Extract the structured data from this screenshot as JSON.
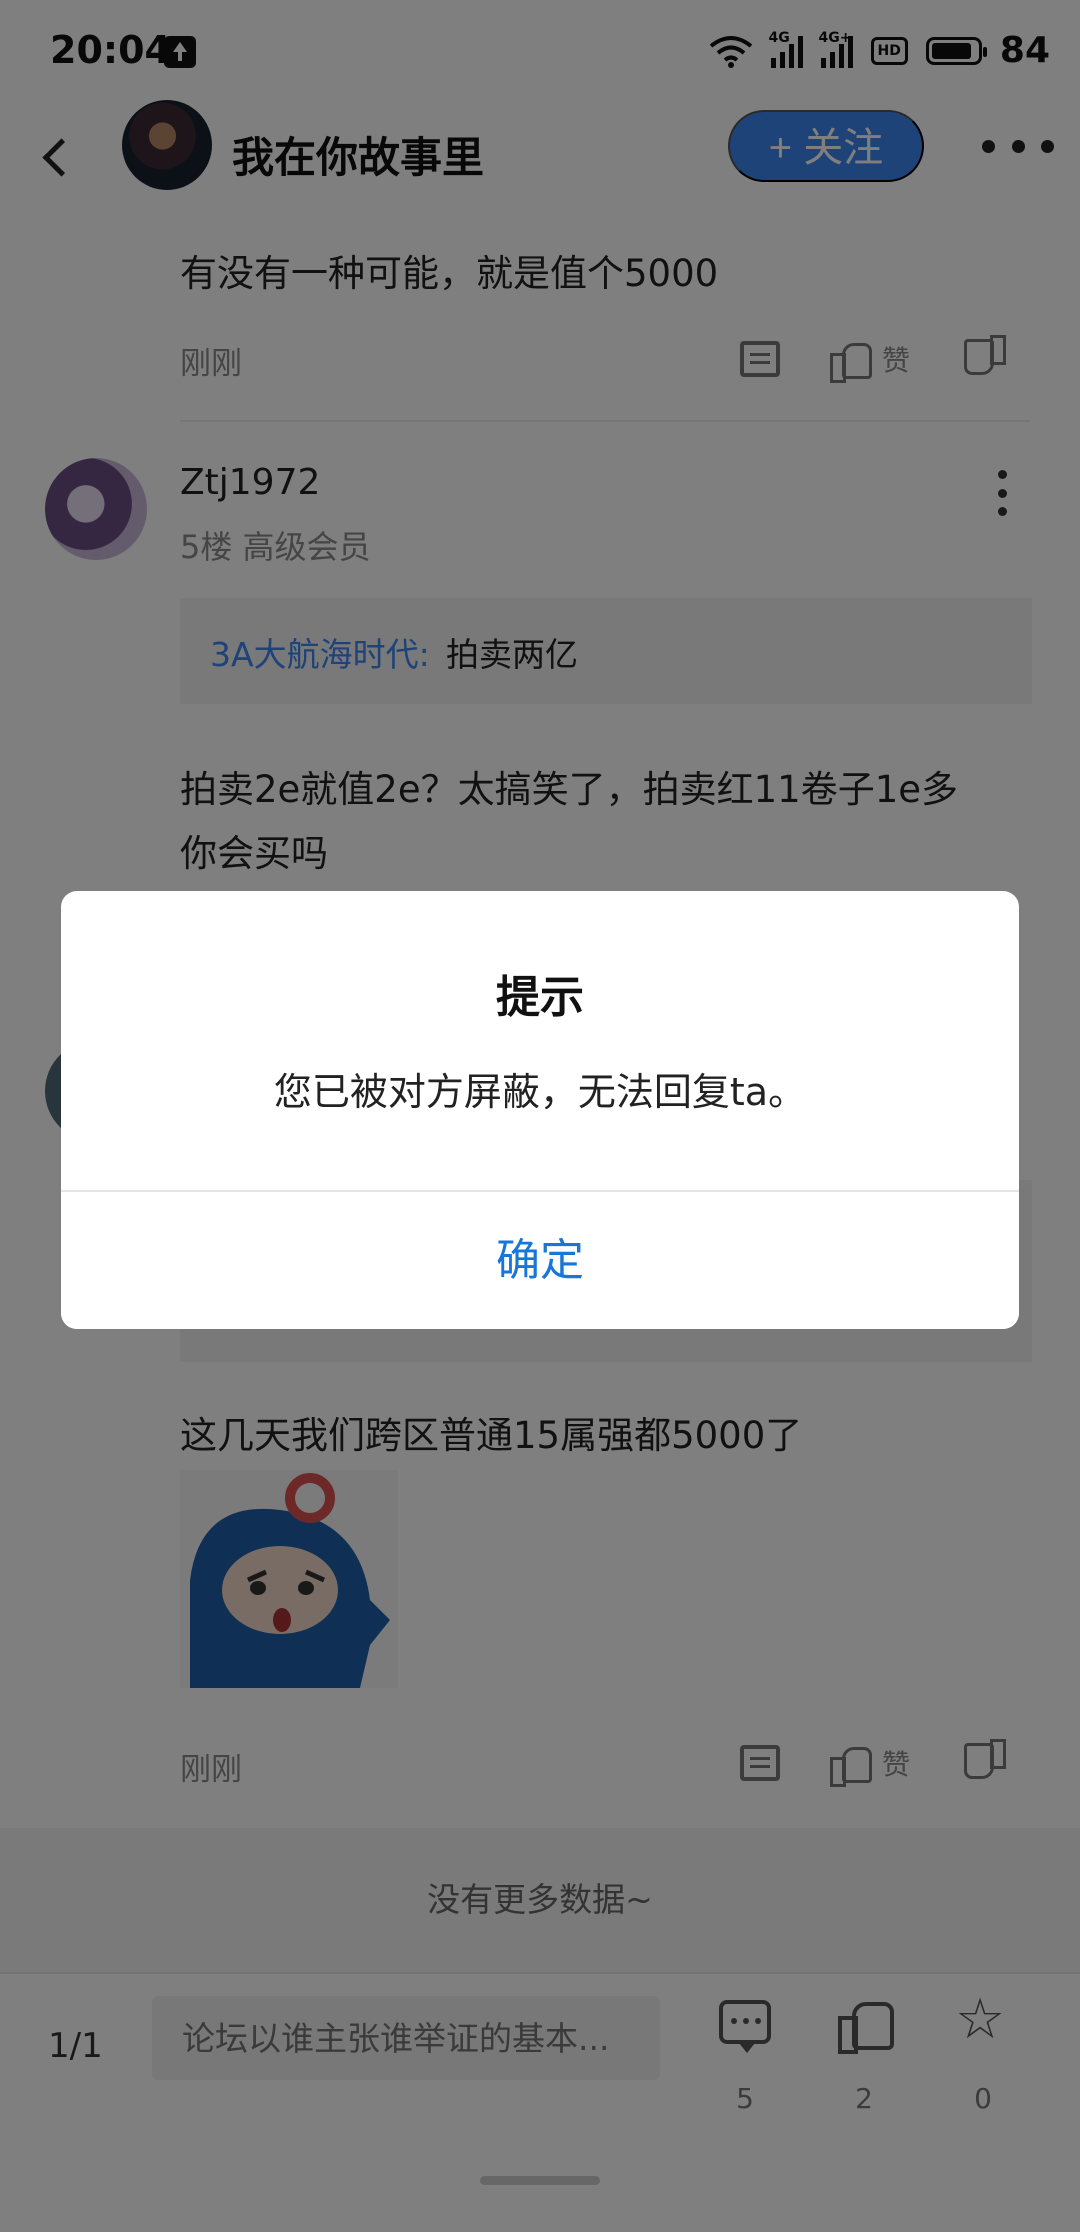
{
  "status_bar": {
    "time": "20:04",
    "signal_1": "4G",
    "signal_2": "4G+",
    "hd_label": "HD",
    "battery": "84"
  },
  "header": {
    "author_name": "我在你故事里",
    "follow_label": "+ 关注"
  },
  "post_1": {
    "text": "有没有一种可能，就是值个5000",
    "time": "刚刚",
    "like_label": "赞"
  },
  "post_2": {
    "username": "Ztj1972",
    "floor_info": "5楼 高级会员",
    "quote_user": "3A大航海时代:",
    "quote_text": "拍卖两亿",
    "text_line1": "拍卖2e就值2e？太搞笑了，拍卖红11卷子1e多",
    "text_line2": "你会买吗"
  },
  "post_3": {
    "text": "这几天我们跨区普通15属强都5000了",
    "time": "刚刚",
    "like_label": "赞"
  },
  "no_more_text": "没有更多数据~",
  "bottom_bar": {
    "page_indicator": "1/1",
    "reply_placeholder": "论坛以谁主张谁举证的基本...",
    "comment_count": "5",
    "like_count": "2",
    "favorite_count": "0"
  },
  "dialog": {
    "title": "提示",
    "message": "您已被对方屏蔽，无法回复ta。",
    "confirm_label": "确定"
  },
  "colors": {
    "accent_blue": "#3d86f0",
    "dialog_button": "#1677d8",
    "overlay": "rgba(0,0,0,0.5)"
  }
}
